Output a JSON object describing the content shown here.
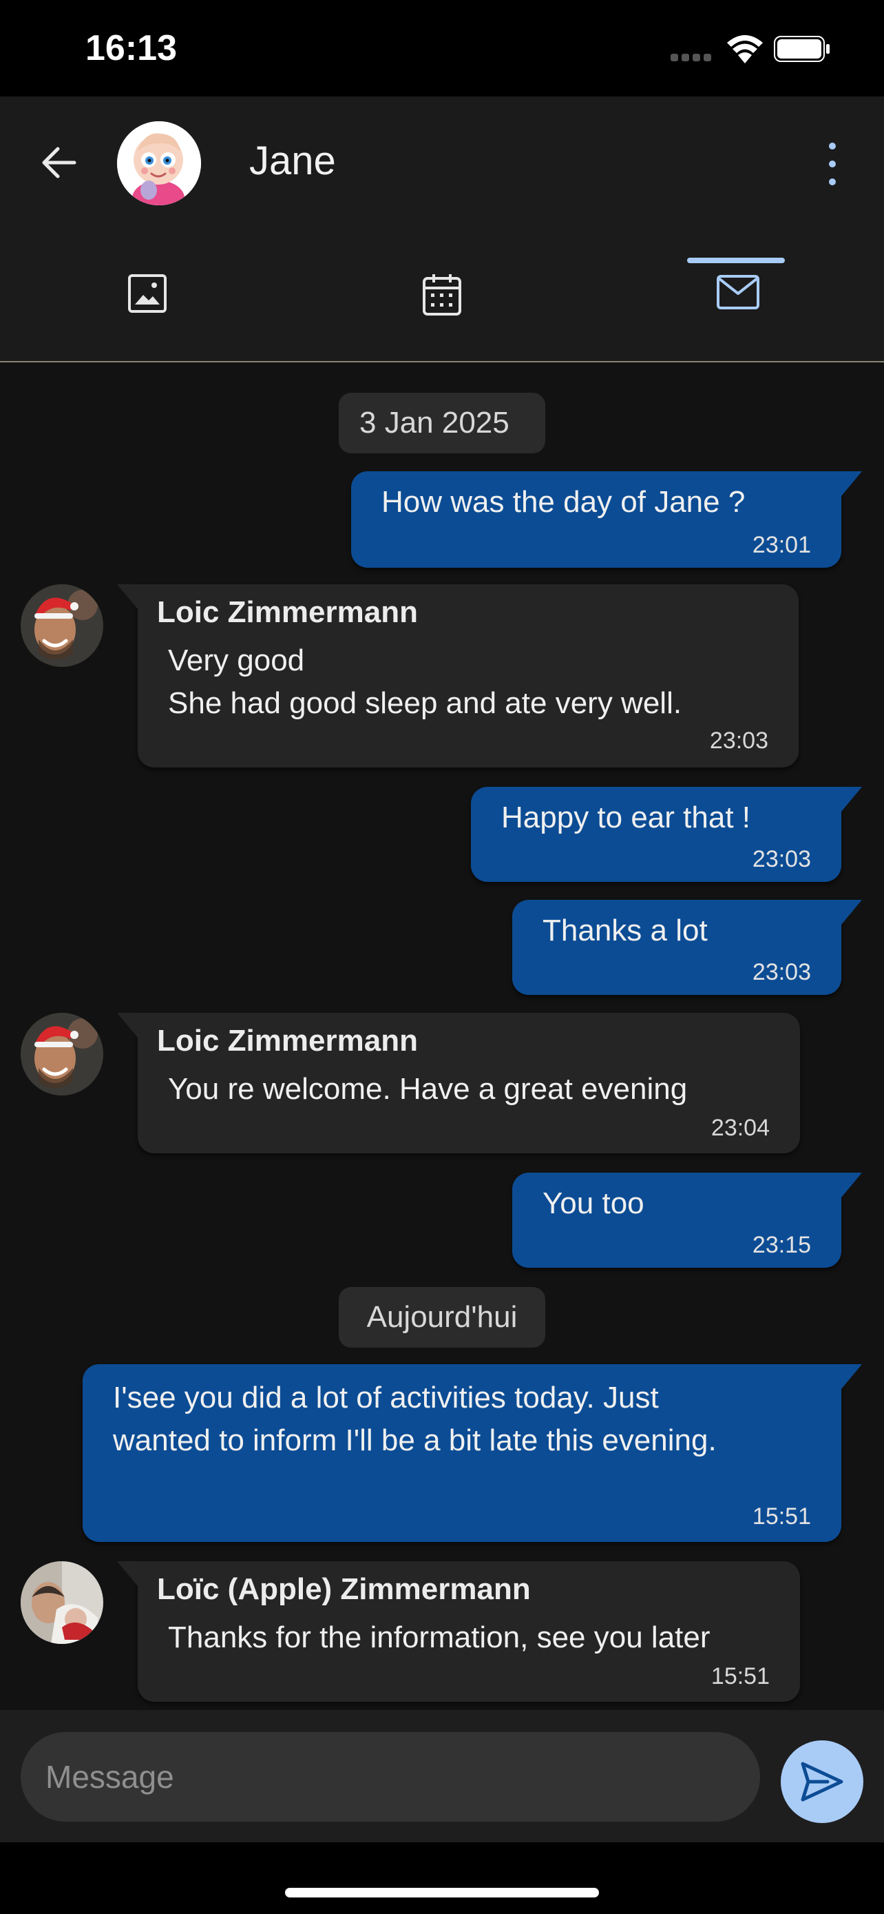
{
  "status_bar": {
    "time": "16:13",
    "icons": [
      "signal-icon",
      "wifi-icon",
      "battery-icon"
    ]
  },
  "header": {
    "contact_name": "Jane",
    "back_icon": "arrow-left-icon",
    "menu_icon": "more-vert-icon",
    "tabs": [
      {
        "name": "photos",
        "icon": "image-icon",
        "active": false
      },
      {
        "name": "calendar",
        "icon": "calendar-icon",
        "active": false
      },
      {
        "name": "messages",
        "icon": "mail-icon",
        "active": true
      }
    ],
    "accent_color": "#a9ccf7"
  },
  "chat": {
    "dates": [
      "3 Jan 2025",
      "Aujourd'hui"
    ],
    "messages": [
      {
        "direction": "out",
        "text": "How was the day of Jane ?",
        "time": "23:01"
      },
      {
        "direction": "in",
        "sender": "Loic Zimmermann",
        "text": "Very good\nShe had good sleep and ate very well.",
        "time": "23:03"
      },
      {
        "direction": "out",
        "text": "Happy to ear that !",
        "time": "23:03"
      },
      {
        "direction": "out",
        "text": "Thanks a lot",
        "time": "23:03"
      },
      {
        "direction": "in",
        "sender": "Loic Zimmermann",
        "text": "You re welcome. Have a great evening",
        "time": "23:04"
      },
      {
        "direction": "out",
        "text": "You too",
        "time": "23:15"
      },
      {
        "direction": "out",
        "text": "I'see you did a lot of activities today. Just\nwanted to inform I'll be a bit late this evening.",
        "time": "15:51"
      },
      {
        "direction": "in",
        "sender": "Loïc (Apple) Zimmermann",
        "text": "Thanks for the information, see you later",
        "time": "15:51"
      }
    ],
    "outgoing_color": "#0c4c94",
    "incoming_color": "#252525"
  },
  "composer": {
    "placeholder": "Message",
    "send_icon": "send-icon"
  }
}
